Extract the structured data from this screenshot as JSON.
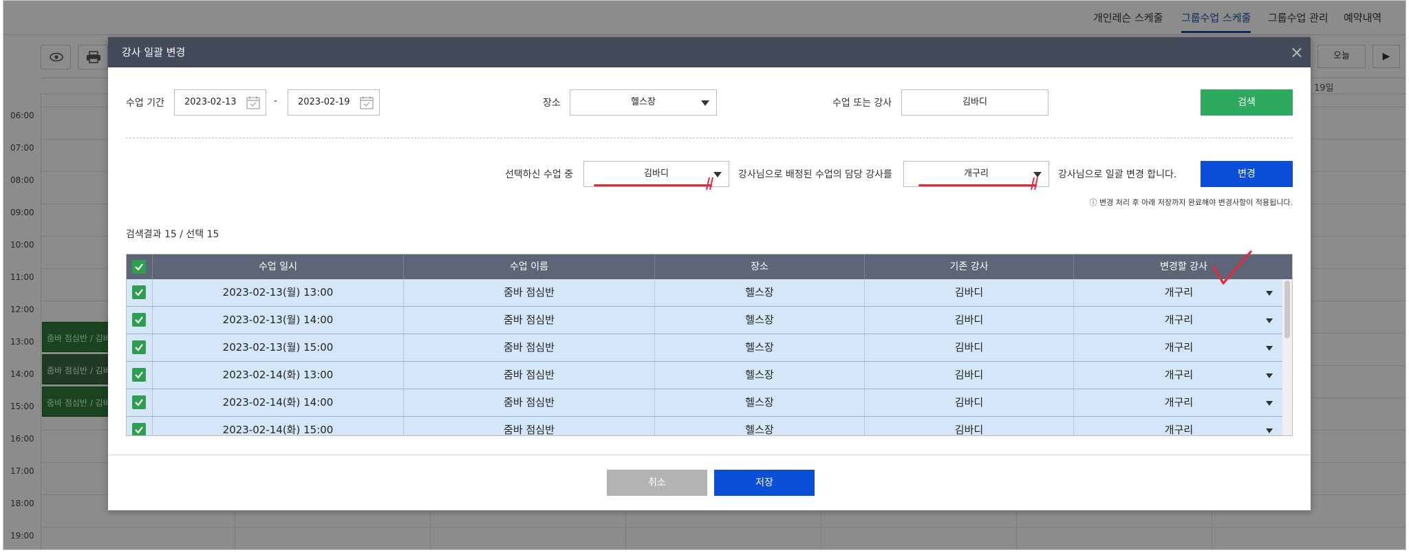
{
  "topnav": {
    "items": [
      {
        "label": "개인레슨 스케줄"
      },
      {
        "label": "그룹수업 스케줄"
      },
      {
        "label": "그룹수업 관리"
      },
      {
        "label": "예약내역"
      }
    ],
    "active_index": 1
  },
  "calendar": {
    "today_label": "오늘",
    "next_label": "▶",
    "date_header": "19일",
    "times": [
      "06:00",
      "07:00",
      "08:00",
      "09:00",
      "10:00",
      "11:00",
      "12:00",
      "13:00",
      "14:00",
      "15:00",
      "16:00",
      "17:00",
      "18:00",
      "19:00"
    ],
    "events": [
      "줌바 점심반 / 김바디",
      "줌바 점심반 / 김바디",
      "줌바 점심반 / 김바디"
    ]
  },
  "modal": {
    "title": "강사 일괄 변경",
    "close_icon": "×",
    "search": {
      "period_label": "수업 기간",
      "date_from": "2023-02-13",
      "date_sep": "-",
      "date_to": "2023-02-19",
      "place_label": "장소",
      "place_value": "헬스장",
      "class_or_trainer_label": "수업 또는 강사",
      "class_or_trainer_value": "김바디",
      "search_button": "검색"
    },
    "bulk_change": {
      "prefix": "선택하신 수업 중",
      "from_trainer": "김바디",
      "middle": "강사님으로 배정된 수업의 담당 강사를",
      "to_trainer": "개구리",
      "suffix": "강사님으로 일괄 변경 합니다.",
      "change_button": "변경",
      "note": "ⓘ 변경 처리 후 아래 저장까지 완료해야 변경사항이 적용됩니다."
    },
    "result_count": "검색결과 15 / 선택 15",
    "table": {
      "headers": [
        "수업 일시",
        "수업 이름",
        "장소",
        "기존 강사",
        "변경할 강사"
      ],
      "rows": [
        {
          "datetime": "2023-02-13(월) 13:00",
          "class": "줌바 점심반",
          "place": "헬스장",
          "old": "김바디",
          "new": "개구리"
        },
        {
          "datetime": "2023-02-13(월) 14:00",
          "class": "줌바 점심반",
          "place": "헬스장",
          "old": "김바디",
          "new": "개구리"
        },
        {
          "datetime": "2023-02-13(월) 15:00",
          "class": "줌바 점심반",
          "place": "헬스장",
          "old": "김바디",
          "new": "개구리"
        },
        {
          "datetime": "2023-02-14(화) 13:00",
          "class": "줌바 점심반",
          "place": "헬스장",
          "old": "김바디",
          "new": "개구리"
        },
        {
          "datetime": "2023-02-14(화) 14:00",
          "class": "줌바 점심반",
          "place": "헬스장",
          "old": "김바디",
          "new": "개구리"
        },
        {
          "datetime": "2023-02-14(화) 15:00",
          "class": "줌바 점심반",
          "place": "헬스장",
          "old": "김바디",
          "new": "개구리"
        }
      ]
    },
    "footer": {
      "cancel_button": "취소",
      "save_button": "저장"
    }
  },
  "colors": {
    "header_bg": "#434a59",
    "search_green": "#2daa5e",
    "primary_blue": "#0b4fd9",
    "row_bg": "#d4e6f7",
    "check_green": "#2e9e4f",
    "annotation_red": "#e3283e"
  }
}
